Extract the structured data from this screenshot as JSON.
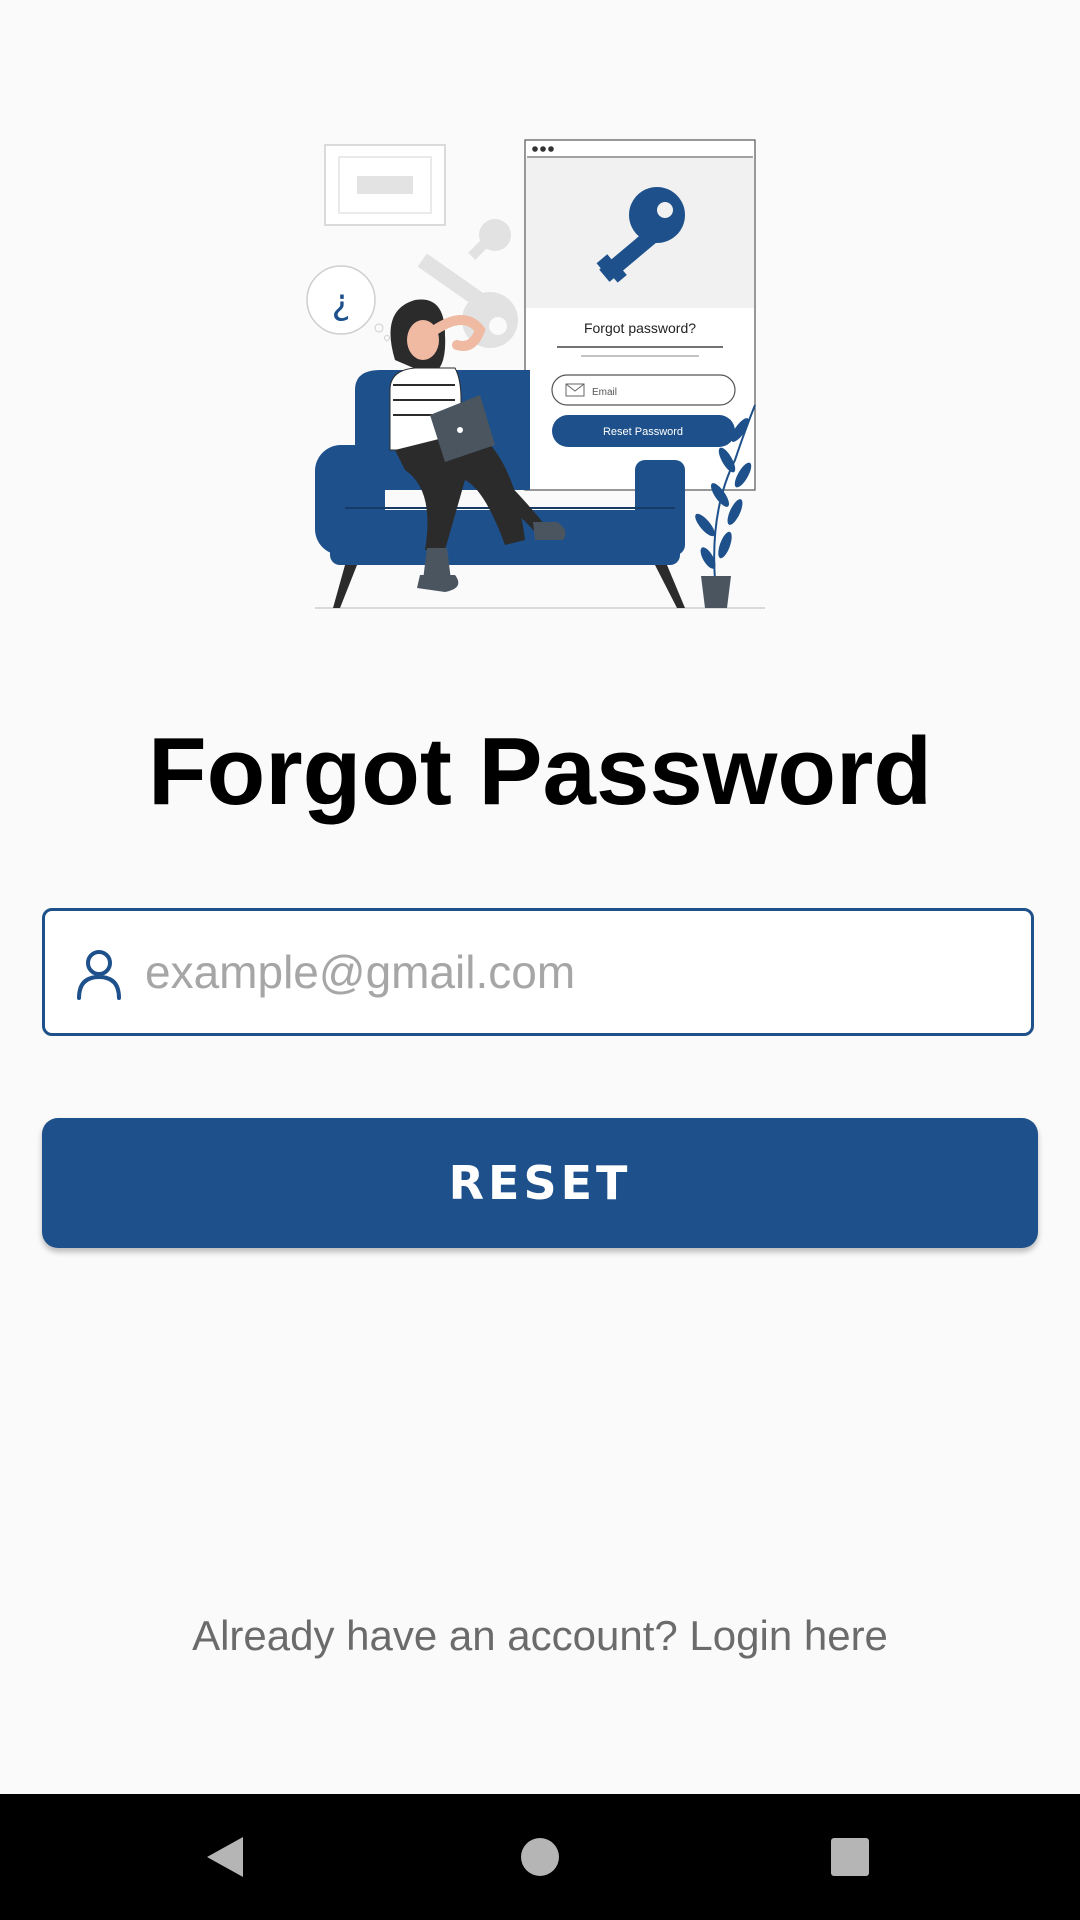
{
  "illustration": {
    "mock_title": "Forgot password?",
    "mock_email_placeholder": "Email",
    "mock_button_label": "Reset Password",
    "question_mark": "¿"
  },
  "title": "Forgot Password",
  "email_field": {
    "placeholder": "example@gmail.com",
    "value": "",
    "icon": "user-icon"
  },
  "reset_button": {
    "label": "RESET"
  },
  "login_link": {
    "label": "Already have an account? Login here"
  },
  "nav_bar": {
    "back_icon": "back-triangle-icon",
    "home_icon": "home-circle-icon",
    "recent_icon": "recent-square-icon"
  },
  "colors": {
    "accent": "#1e518b",
    "background": "#fafafa",
    "placeholder": "#a6a6a6",
    "link_text": "#6b6b6b"
  }
}
